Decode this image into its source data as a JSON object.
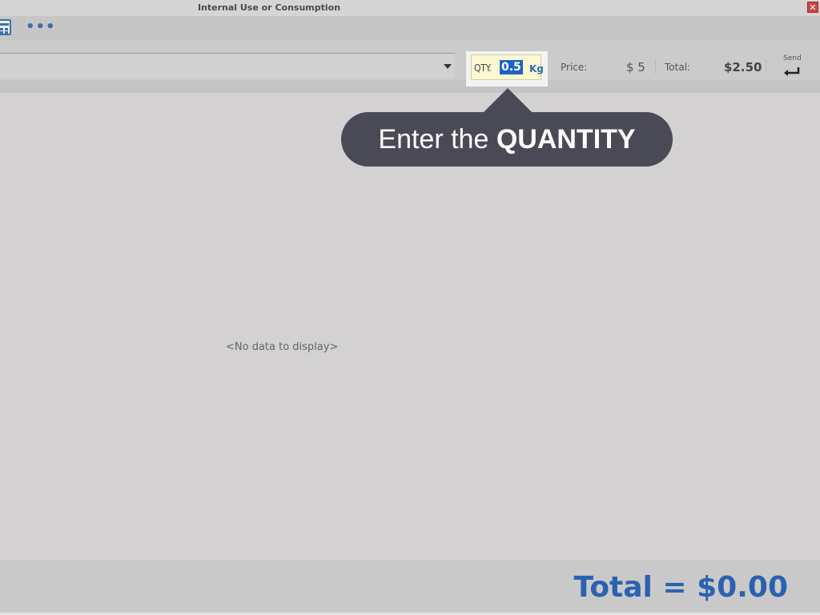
{
  "window": {
    "title": "Internal Use or Consumption",
    "close_glyph": "✕"
  },
  "toolbar": {
    "calculator_icon": "calculator-icon",
    "more_icon": "more-dots-icon",
    "more_glyph": "•••"
  },
  "entry": {
    "product_value": "",
    "qty_label": "QTY.",
    "qty_value": "0.5",
    "qty_unit": "Kg",
    "price_label": "Price:",
    "price_value": "$ 5",
    "total_label": "Total:",
    "total_value": "$2.50",
    "send_label": "Send",
    "send_icon": "enter-return-icon"
  },
  "tooltip": {
    "prefix": "Enter the ",
    "emphasis": "QUANTITY"
  },
  "grid": {
    "empty_message": "<No data to display>"
  },
  "footer": {
    "grand_total": "Total = $0.00"
  },
  "colors": {
    "accent": "#2b62b0",
    "tooltip_bg": "#4a4a56",
    "qty_highlight": "#1c63c8"
  }
}
